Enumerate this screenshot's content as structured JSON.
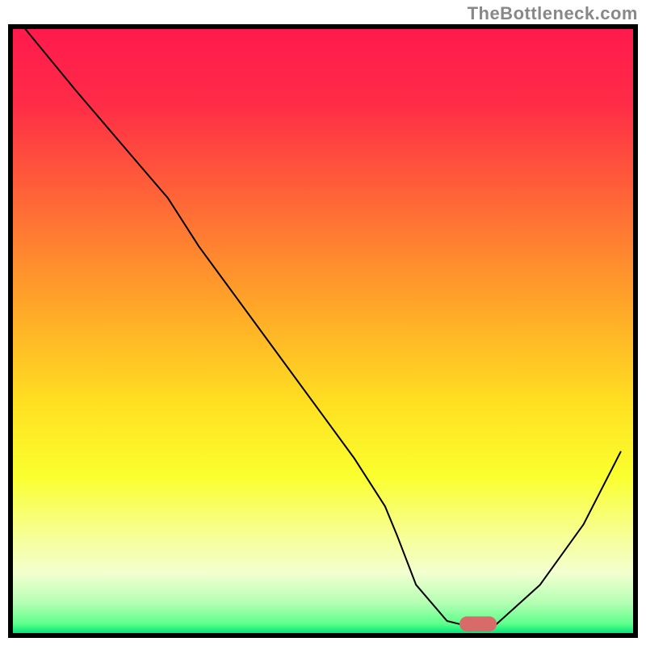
{
  "watermark": "TheBottleneck.com",
  "chart_data": {
    "type": "line",
    "title": "",
    "xlabel": "",
    "ylabel": "",
    "xlim": [
      0,
      100
    ],
    "ylim": [
      0,
      100
    ],
    "axes_visible": false,
    "grid": false,
    "background_gradient": {
      "stops": [
        {
          "offset": 0.0,
          "color": "#ff1a4d"
        },
        {
          "offset": 0.12,
          "color": "#ff2b47"
        },
        {
          "offset": 0.25,
          "color": "#ff5a3a"
        },
        {
          "offset": 0.38,
          "color": "#ff8a2e"
        },
        {
          "offset": 0.5,
          "color": "#ffb526"
        },
        {
          "offset": 0.62,
          "color": "#ffe021"
        },
        {
          "offset": 0.74,
          "color": "#faff2e"
        },
        {
          "offset": 0.83,
          "color": "#f7ff8c"
        },
        {
          "offset": 0.9,
          "color": "#f3ffd0"
        },
        {
          "offset": 0.95,
          "color": "#b4ffb4"
        },
        {
          "offset": 0.985,
          "color": "#5cff8a"
        },
        {
          "offset": 1.0,
          "color": "#00e67a"
        }
      ]
    },
    "series": [
      {
        "name": "bottleneck-curve",
        "stroke": "#000000",
        "stroke_width": 2,
        "x": [
          2,
          10,
          20,
          25,
          30,
          40,
          50,
          55,
          60,
          62,
          65,
          70,
          72,
          78,
          85,
          92,
          98
        ],
        "y": [
          100,
          90,
          78,
          72,
          64,
          50,
          36,
          29,
          21,
          16,
          8,
          2,
          1.5,
          1.5,
          8,
          18,
          30
        ]
      }
    ],
    "marker": {
      "name": "optimal-point",
      "x": 75,
      "y": 1.5,
      "width": 6,
      "height": 2.5,
      "color": "#d86a6a",
      "shape": "capsule"
    },
    "border": {
      "color": "#000000",
      "width": 6
    }
  }
}
